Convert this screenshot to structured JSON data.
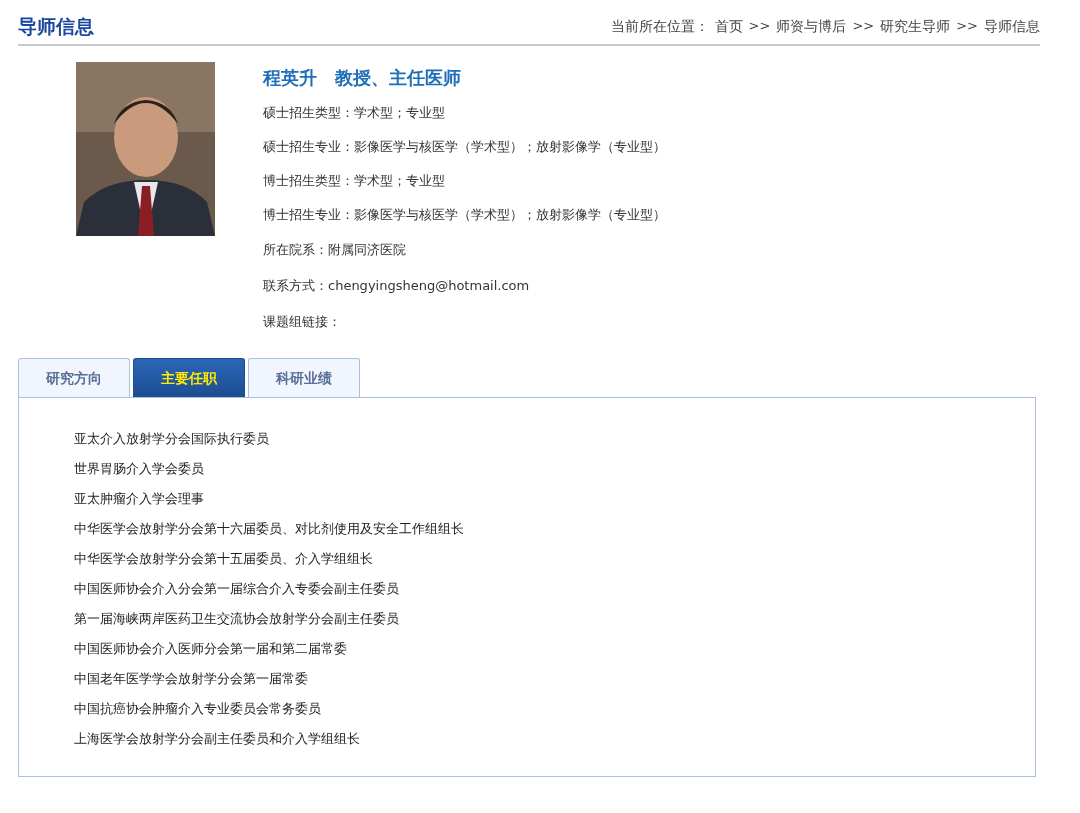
{
  "header": {
    "title": "导师信息",
    "breadcrumb": [
      {
        "kind": "label",
        "text": "当前所在位置："
      },
      {
        "kind": "link",
        "text": "首页"
      },
      {
        "kind": "separator",
        "text": ">>"
      },
      {
        "kind": "link",
        "text": "师资与博后"
      },
      {
        "kind": "separator",
        "text": ">>"
      },
      {
        "kind": "link",
        "text": "研究生导师"
      },
      {
        "kind": "separator",
        "text": ">>"
      },
      {
        "kind": "link",
        "text": "导师信息"
      }
    ]
  },
  "profile": {
    "name": "程英升",
    "position": "教授、主任医师",
    "fields": [
      {
        "label": "硕士招生类型：",
        "value": "学术型；专业型"
      },
      {
        "label": "硕士招生专业：",
        "value": "影像医学与核医学（学术型）；放射影像学（专业型）"
      },
      {
        "label": "博士招生类型：",
        "value": "学术型；专业型"
      },
      {
        "label": "博士招生专业：",
        "value": "影像医学与核医学（学术型）；放射影像学（专业型）"
      },
      {
        "label": "所在院系：",
        "value": "附属同济医院"
      },
      {
        "label": "联系方式：",
        "value": "chengyingsheng@hotmail.com"
      },
      {
        "label": "课题组链接："
      }
    ]
  },
  "tabs": [
    {
      "label": "研究方向",
      "selected": false
    },
    {
      "label": "主要任职",
      "selected": true
    },
    {
      "label": "科研业绩",
      "selected": false
    }
  ],
  "positions": [
    "亚太介入放射学分会国际执行委员",
    "世界胃肠介入学会委员",
    "亚太肿瘤介入学会理事",
    "中华医学会放射学分会第十六届委员、对比剂使用及安全工作组组长",
    "中华医学会放射学分会第十五届委员、介入学组组长",
    "中国医师协会介入分会第一届综合介入专委会副主任委员",
    "第一届海峡两岸医药卫生交流协会放射学分会副主任委员",
    "中国医师协会介入医师分会第一届和第二届常委",
    "中国老年医学学会放射学分会第一届常委",
    "中国抗癌协会肿瘤介入专业委员会常务委员",
    "上海医学会放射学分会副主任委员和介入学组组长"
  ]
}
